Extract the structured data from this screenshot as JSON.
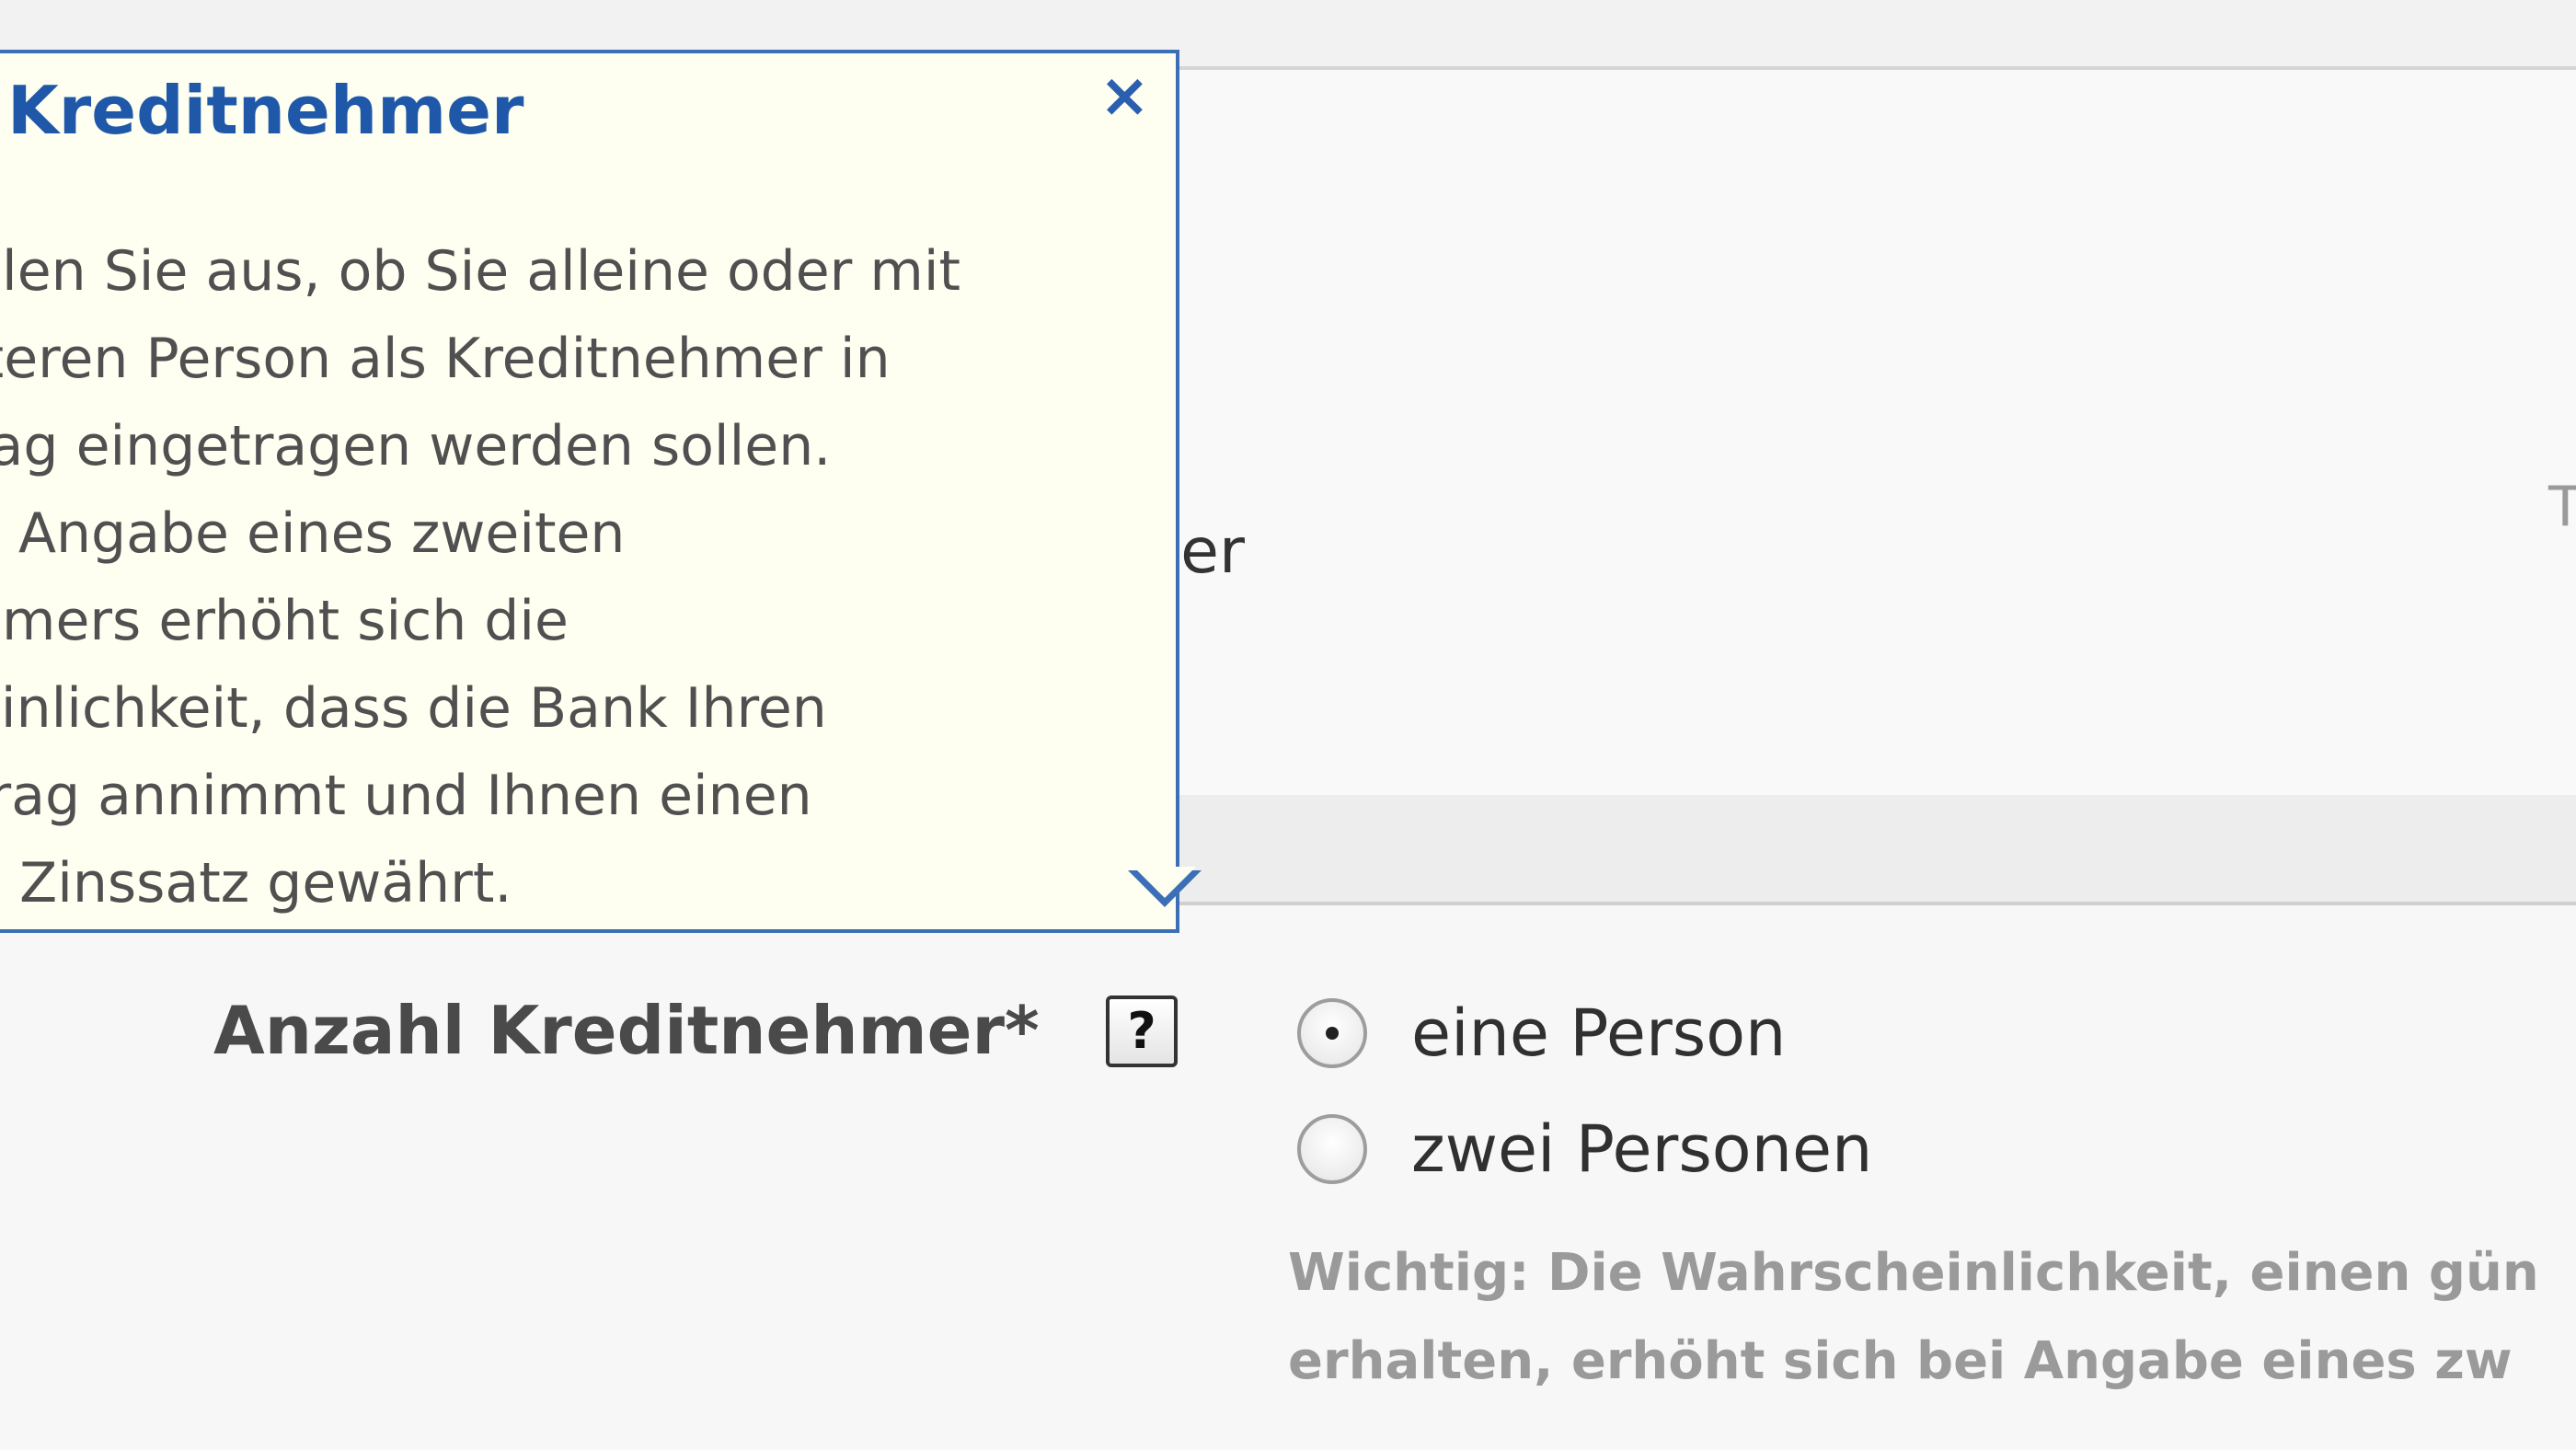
{
  "popup": {
    "title": "Kreditnehmer",
    "close_glyph": "×",
    "body_lines": [
      "hlen Sie aus, ob Sie alleine oder mit",
      "iteren Person als Kreditnehmer in",
      "rag eingetragen werden sollen.",
      "e Angabe eines zweiten",
      "hmers erhöht sich die",
      "einlichkeit, dass die Bank Ihren",
      "trag annimmt und Ihnen einen",
      "n Zinssatz gewährt."
    ]
  },
  "background": {
    "partial_text": "ber",
    "edge_letter": "T"
  },
  "form": {
    "field_label": "Anzahl Kreditnehmer*",
    "help_button": "?",
    "options": [
      {
        "label": "eine Person",
        "selected": true
      },
      {
        "label": "zwei Personen",
        "selected": false
      }
    ],
    "note_lines": [
      "Wichtig: Die Wahrscheinlichkeit, einen gün",
      "erhalten, erhöht sich bei Angabe eines zw"
    ]
  },
  "colors": {
    "popup_border": "#3b6fb6",
    "popup_bg": "#fefff1",
    "popup_title": "#1f58a8",
    "note_text": "#9a9a9a"
  },
  "icons": {
    "close": "close-icon",
    "help": "help-icon"
  }
}
